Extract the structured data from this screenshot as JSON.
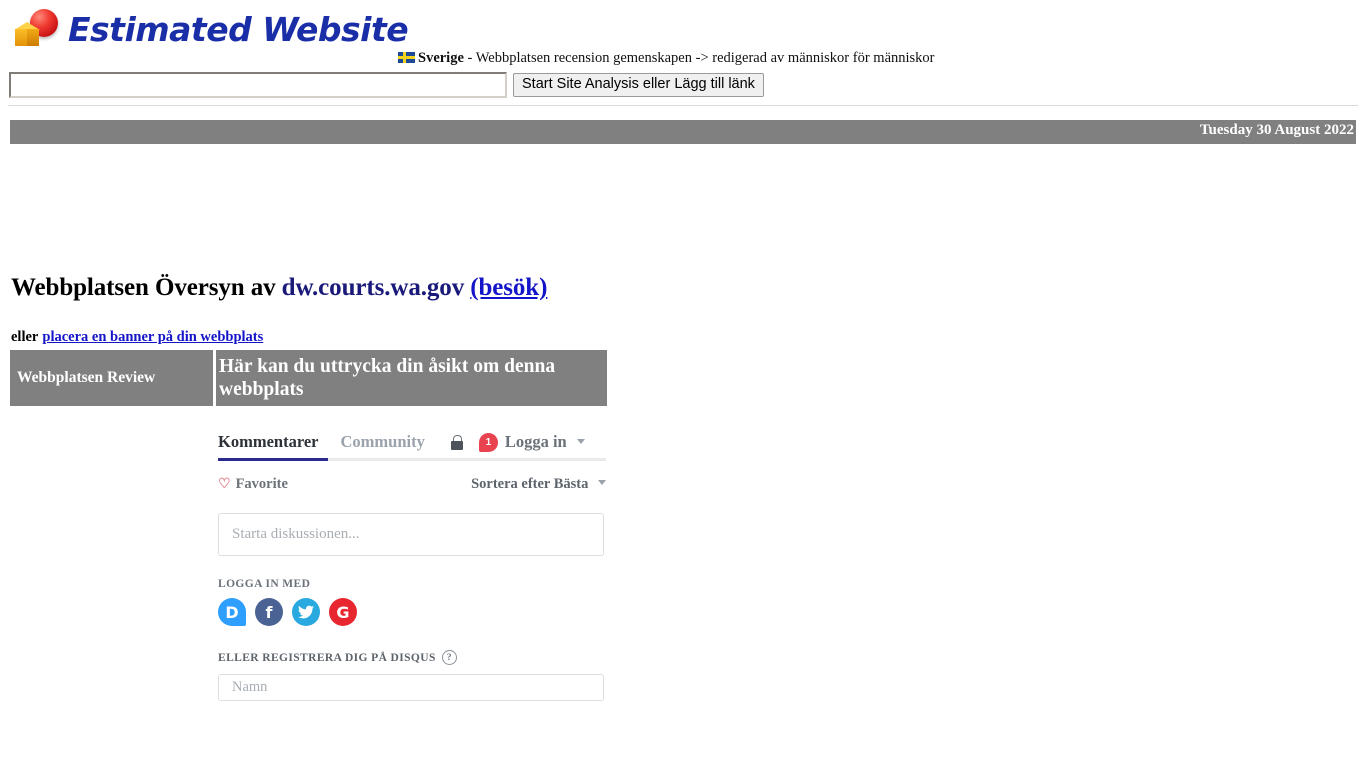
{
  "header": {
    "logo_text": "Estimated Website",
    "logo_icon": "cube-sphere-logo",
    "country": "Sverige",
    "tagline_separator": " - ",
    "tagline": "Webbplatsen recension gemenskapen -> redigerad av människor för människor",
    "search_value": "",
    "search_placeholder": "",
    "analyze_button": "Start Site Analysis eller Lägg till länk"
  },
  "date_bar": {
    "date": "Tuesday 30 August 2022"
  },
  "main": {
    "title_prefix": "Webbplatsen Översyn av",
    "site_name": "dw.courts.wa.gov",
    "visit_link": "(besök)",
    "banner_prefix": "eller",
    "banner_link": "placera en banner på din webbplats",
    "review_cell_label": "Webbplatsen Review",
    "review_cell_heading": "Här kan du uttrycka din åsikt om denna webbplats"
  },
  "disqus": {
    "tabs": [
      {
        "label": "Kommentarer",
        "active": true
      },
      {
        "label": "Community",
        "active": false
      }
    ],
    "lock_icon": "lock-icon",
    "badge_count": "1",
    "login_label": "Logga in",
    "caret_icon": "chevron-down-icon",
    "favorite_label": "Favorite",
    "favorite_icon": "heart-outline-icon",
    "sort_label": "Sortera efter Bästa",
    "comment_placeholder": "Starta diskussionen...",
    "social_label": "LOGGA IN MED",
    "social_buttons": [
      {
        "name": "disqus",
        "glyph": "D",
        "color": "#2e9fff"
      },
      {
        "name": "facebook",
        "glyph": "f",
        "color": "#4a6294"
      },
      {
        "name": "twitter",
        "glyph": "✓",
        "color": "#2aa9e0"
      },
      {
        "name": "google",
        "glyph": "G",
        "color": "#e8262f"
      }
    ],
    "register_label": "ELLER REGISTRERA DIG PÅ DISQUS",
    "help_icon": "question-mark-icon",
    "help_glyph": "?",
    "name_placeholder": "Namn"
  },
  "colors": {
    "brand_blue": "#1a2ea8",
    "link_blue": "#1414c8",
    "gray_bar": "#808080",
    "accent_navy": "#2b2b8f",
    "badge_red": "#e8434f"
  }
}
